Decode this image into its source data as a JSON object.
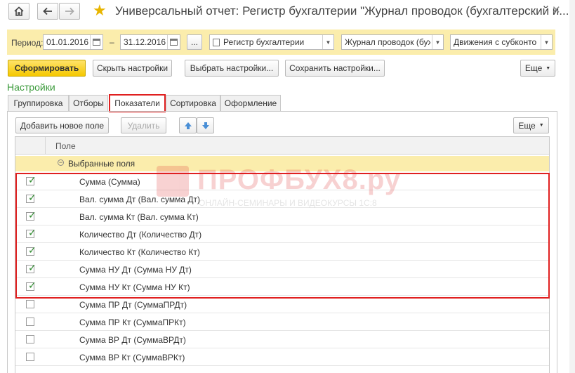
{
  "window": {
    "title": "Универсальный отчет: Регистр бухгалтерии \"Журнал проводок (бухгалтерский и..."
  },
  "filters": {
    "period_label": "Период:",
    "date_from": "01.01.2016",
    "dash": "–",
    "date_to": "31.12.2016",
    "more": "...",
    "register_type": "Регистр бухгалтерии",
    "register_name": "Журнал проводок (бухгалтерский и налоговый учет)",
    "mode": "Движения с субконто"
  },
  "toolbar": {
    "generate": "Сформировать",
    "hide_settings": "Скрыть настройки",
    "choose_settings": "Выбрать настройки...",
    "save_settings": "Сохранить настройки...",
    "more": "Еще"
  },
  "settings": {
    "title": "Настройки",
    "tabs": [
      {
        "label": "Группировка"
      },
      {
        "label": "Отборы"
      },
      {
        "label": "Показатели"
      },
      {
        "label": "Сортировка"
      },
      {
        "label": "Оформление"
      }
    ],
    "active_tab": "Показатели"
  },
  "fields_toolbar": {
    "add_field": "Добавить новое поле",
    "delete": "Удалить",
    "more": "Еще"
  },
  "table": {
    "header": "Поле",
    "group": "Выбранные поля",
    "rows": [
      {
        "label": "Сумма (Сумма)",
        "checked": true
      },
      {
        "label": "Вал. сумма Дт (Вал. сумма Дт)",
        "checked": true
      },
      {
        "label": "Вал. сумма Кт (Вал. сумма Кт)",
        "checked": true
      },
      {
        "label": "Количество Дт (Количество Дт)",
        "checked": true
      },
      {
        "label": "Количество Кт (Количество Кт)",
        "checked": true
      },
      {
        "label": "Сумма НУ Дт (Сумма НУ Дт)",
        "checked": true
      },
      {
        "label": "Сумма НУ Кт (Сумма НУ Кт)",
        "checked": true
      },
      {
        "label": "Сумма ПР Дт (СуммаПРДт)",
        "checked": false
      },
      {
        "label": "Сумма ПР Кт (СуммаПРКт)",
        "checked": false
      },
      {
        "label": "Сумма ВР Дт (СуммаВРДт)",
        "checked": false
      },
      {
        "label": "Сумма ВР Кт (СуммаВРКт)",
        "checked": false
      }
    ]
  },
  "watermark": {
    "brand": "ПРОФБУХ8.ру",
    "tagline": "ОНЛАЙН-СЕМИНАРЫ И ВИДЕОКУРСЫ 1С:8"
  },
  "icons": {
    "home": "home-icon",
    "back": "arrow-left-icon",
    "forward": "arrow-right-icon",
    "favorite": "star-icon",
    "close": "close-icon",
    "calendar": "calendar-icon",
    "move_up": "arrow-up-icon",
    "move_down": "arrow-down-icon"
  },
  "colors": {
    "accent_yellow": "#f5c800",
    "filter_bg": "#fbedac",
    "section_green": "#3a9a3a",
    "highlight_red": "#e02020"
  }
}
